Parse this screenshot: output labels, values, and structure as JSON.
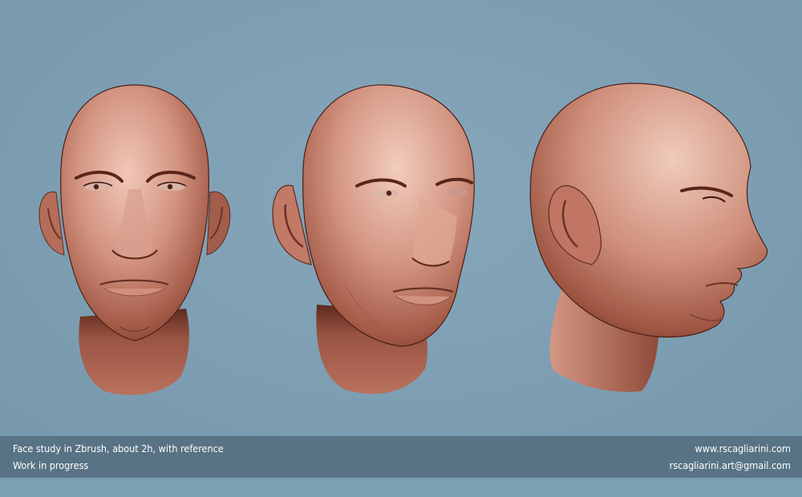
{
  "caption": {
    "left_line1": "Face study in Zbrush, about 2h, with reference",
    "left_line2": "Work in progress",
    "right_line1": "www.rscagliarini.com",
    "right_line2": "rscagliarini.art@gmail.com"
  },
  "colors": {
    "background": "#7d9fb3",
    "caption_bar": "#587384",
    "skin_highlight": "#f1c8b8",
    "skin_mid": "#c07c66",
    "skin_shadow": "#5c2a20"
  }
}
